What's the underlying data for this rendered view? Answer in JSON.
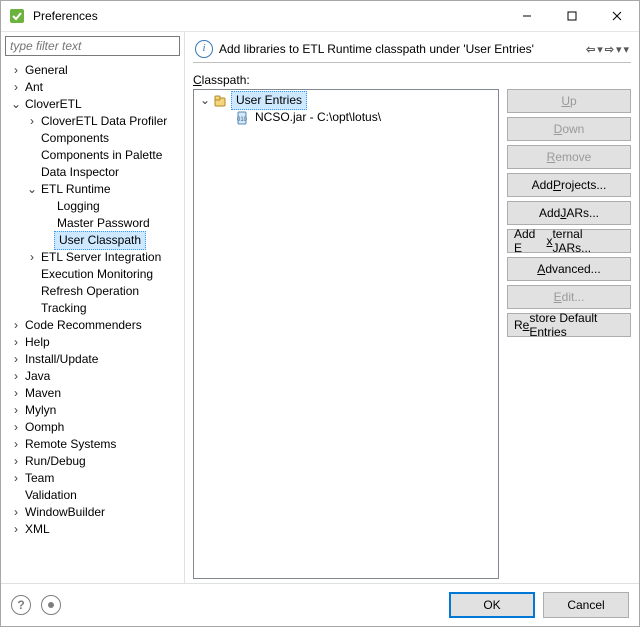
{
  "window": {
    "title": "Preferences"
  },
  "sidebar": {
    "filter_placeholder": "type filter text",
    "items": [
      {
        "label": "General",
        "indent": 0,
        "twisty": "closed",
        "selected": false
      },
      {
        "label": "Ant",
        "indent": 0,
        "twisty": "closed",
        "selected": false
      },
      {
        "label": "CloverETL",
        "indent": 0,
        "twisty": "open",
        "selected": false
      },
      {
        "label": "CloverETL Data Profiler",
        "indent": 1,
        "twisty": "closed",
        "selected": false
      },
      {
        "label": "Components",
        "indent": 1,
        "twisty": "none",
        "selected": false
      },
      {
        "label": "Components in Palette",
        "indent": 1,
        "twisty": "none",
        "selected": false
      },
      {
        "label": "Data Inspector",
        "indent": 1,
        "twisty": "none",
        "selected": false
      },
      {
        "label": "ETL Runtime",
        "indent": 1,
        "twisty": "open",
        "selected": false
      },
      {
        "label": "Logging",
        "indent": 2,
        "twisty": "none",
        "selected": false
      },
      {
        "label": "Master Password",
        "indent": 2,
        "twisty": "none",
        "selected": false
      },
      {
        "label": "User Classpath",
        "indent": 2,
        "twisty": "none",
        "selected": true
      },
      {
        "label": "ETL Server Integration",
        "indent": 1,
        "twisty": "closed",
        "selected": false
      },
      {
        "label": "Execution Monitoring",
        "indent": 1,
        "twisty": "none",
        "selected": false
      },
      {
        "label": "Refresh Operation",
        "indent": 1,
        "twisty": "none",
        "selected": false
      },
      {
        "label": "Tracking",
        "indent": 1,
        "twisty": "none",
        "selected": false
      },
      {
        "label": "Code Recommenders",
        "indent": 0,
        "twisty": "closed",
        "selected": false
      },
      {
        "label": "Help",
        "indent": 0,
        "twisty": "closed",
        "selected": false
      },
      {
        "label": "Install/Update",
        "indent": 0,
        "twisty": "closed",
        "selected": false
      },
      {
        "label": "Java",
        "indent": 0,
        "twisty": "closed",
        "selected": false
      },
      {
        "label": "Maven",
        "indent": 0,
        "twisty": "closed",
        "selected": false
      },
      {
        "label": "Mylyn",
        "indent": 0,
        "twisty": "closed",
        "selected": false
      },
      {
        "label": "Oomph",
        "indent": 0,
        "twisty": "closed",
        "selected": false
      },
      {
        "label": "Remote Systems",
        "indent": 0,
        "twisty": "closed",
        "selected": false
      },
      {
        "label": "Run/Debug",
        "indent": 0,
        "twisty": "closed",
        "selected": false
      },
      {
        "label": "Team",
        "indent": 0,
        "twisty": "closed",
        "selected": false
      },
      {
        "label": "Validation",
        "indent": 0,
        "twisty": "none",
        "selected": false
      },
      {
        "label": "WindowBuilder",
        "indent": 0,
        "twisty": "closed",
        "selected": false
      },
      {
        "label": "XML",
        "indent": 0,
        "twisty": "closed",
        "selected": false
      }
    ]
  },
  "page": {
    "title": "Add libraries to ETL Runtime classpath under 'User Entries'",
    "classpath_label": "Classpath:",
    "entries": [
      {
        "label": "User Entries",
        "indent": 0,
        "twisty": "open",
        "icon": "user-entries-icon",
        "selected": true
      },
      {
        "label": "NCSO.jar - C:\\opt\\lotus\\",
        "indent": 1,
        "twisty": "none",
        "icon": "jar-icon",
        "selected": false
      }
    ],
    "buttons": {
      "up": {
        "label": "Up",
        "mnemonic": "U",
        "enabled": false
      },
      "down": {
        "label": "Down",
        "mnemonic": "D",
        "enabled": false
      },
      "remove": {
        "label": "Remove",
        "mnemonic": "R",
        "enabled": false
      },
      "addproj": {
        "label": "Add Projects...",
        "mnemonic": "P",
        "enabled": true
      },
      "addjars": {
        "label": "Add JARs...",
        "mnemonic": "J",
        "enabled": true
      },
      "addext": {
        "label": "Add External JARs...",
        "mnemonic": "x",
        "enabled": true
      },
      "advanced": {
        "label": "Advanced...",
        "mnemonic": "A",
        "enabled": true
      },
      "edit": {
        "label": "Edit...",
        "mnemonic": "E",
        "enabled": false
      },
      "restore": {
        "label": "Restore Default Entries",
        "mnemonic": "e",
        "enabled": true
      }
    }
  },
  "footer": {
    "ok": "OK",
    "cancel": "Cancel"
  }
}
